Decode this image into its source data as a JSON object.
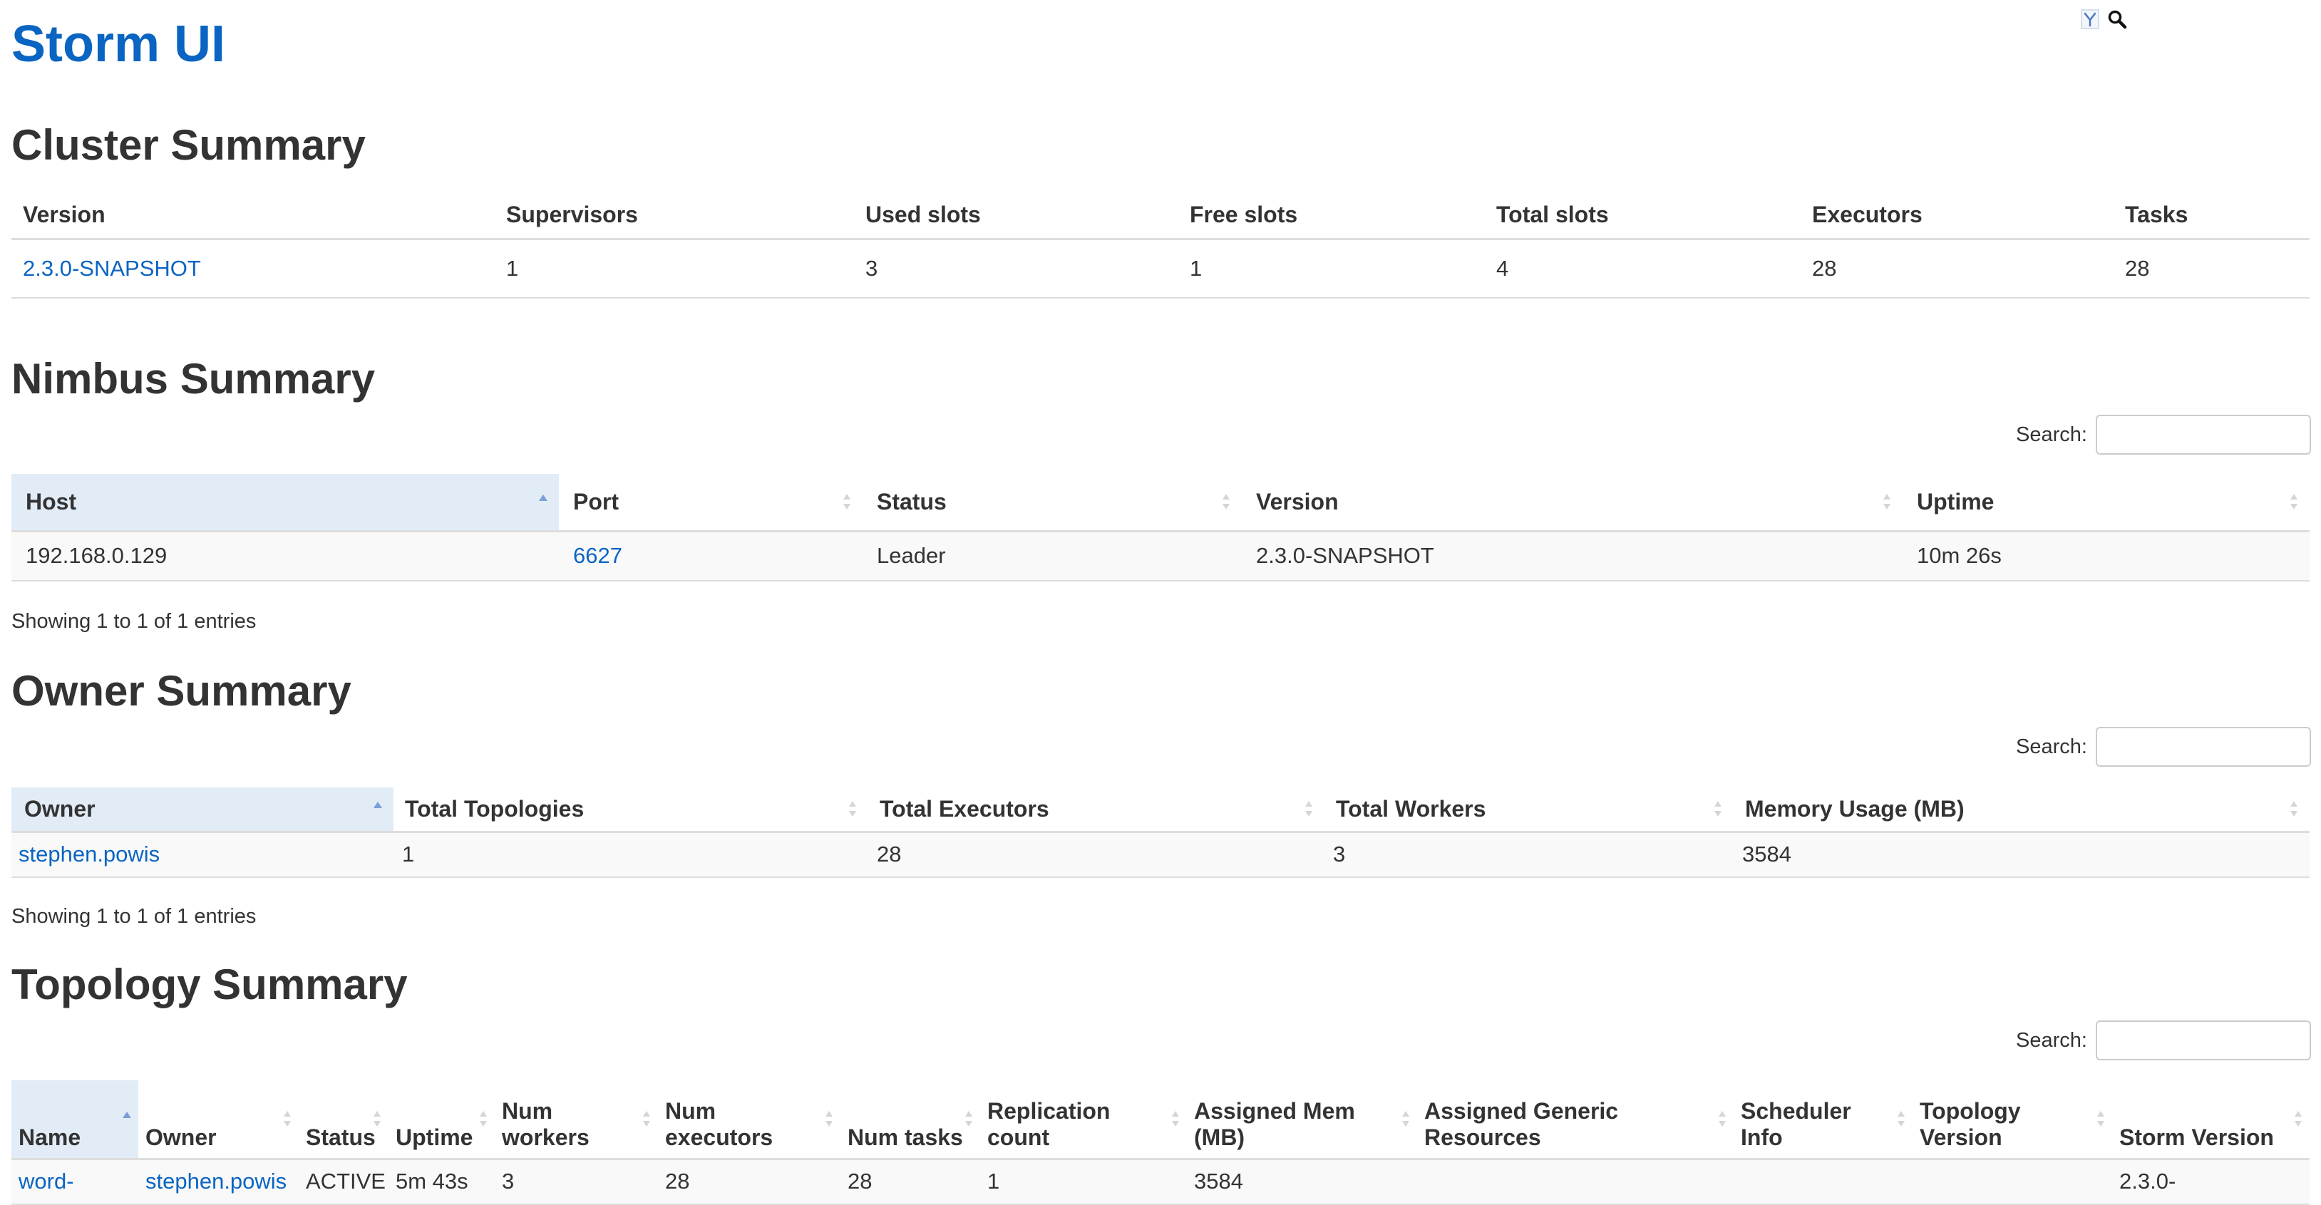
{
  "app": {
    "title": "Storm UI"
  },
  "icons": {
    "filter": "filter-icon",
    "search": "search-icon"
  },
  "colors": {
    "link": "#0a64c2",
    "sorted_header": "#e1ecf7",
    "sort_arrow": "#7b9fd8"
  },
  "cluster_summary": {
    "title": "Cluster Summary",
    "headers": [
      "Version",
      "Supervisors",
      "Used slots",
      "Free slots",
      "Total slots",
      "Executors",
      "Tasks"
    ],
    "row": [
      "2.3.0-SNAPSHOT",
      "1",
      "3",
      "1",
      "4",
      "28",
      "28"
    ]
  },
  "nimbus_summary": {
    "title": "Nimbus Summary",
    "search_label": "Search:",
    "search_value": "",
    "headers": [
      "Host",
      "Port",
      "Status",
      "Version",
      "Uptime"
    ],
    "rows": [
      [
        "192.168.0.129",
        "6627",
        "Leader",
        "2.3.0-SNAPSHOT",
        "10m 26s"
      ]
    ],
    "info": "Showing 1 to 1 of 1 entries"
  },
  "owner_summary": {
    "title": "Owner Summary",
    "search_label": "Search:",
    "search_value": "",
    "headers": [
      "Owner",
      "Total Topologies",
      "Total Executors",
      "Total Workers",
      "Memory Usage (MB)"
    ],
    "rows": [
      [
        "stephen.powis",
        "1",
        "28",
        "3",
        "3584"
      ]
    ],
    "info": "Showing 1 to 1 of 1 entries"
  },
  "topology_summary": {
    "title": "Topology Summary",
    "search_label": "Search:",
    "search_value": "",
    "headers": [
      "Name",
      "Owner",
      "Status",
      "Uptime",
      "Num workers",
      "Num executors",
      "Num tasks",
      "Replication count",
      "Assigned Mem (MB)",
      "Assigned Generic Resources",
      "Scheduler Info",
      "Topology Version",
      "Storm Version"
    ],
    "rows": [
      [
        "word-",
        "stephen.powis",
        "ACTIVE",
        "5m 43s",
        "3",
        "28",
        "28",
        "1",
        "3584",
        "",
        "",
        "",
        "2.3.0-"
      ]
    ]
  }
}
